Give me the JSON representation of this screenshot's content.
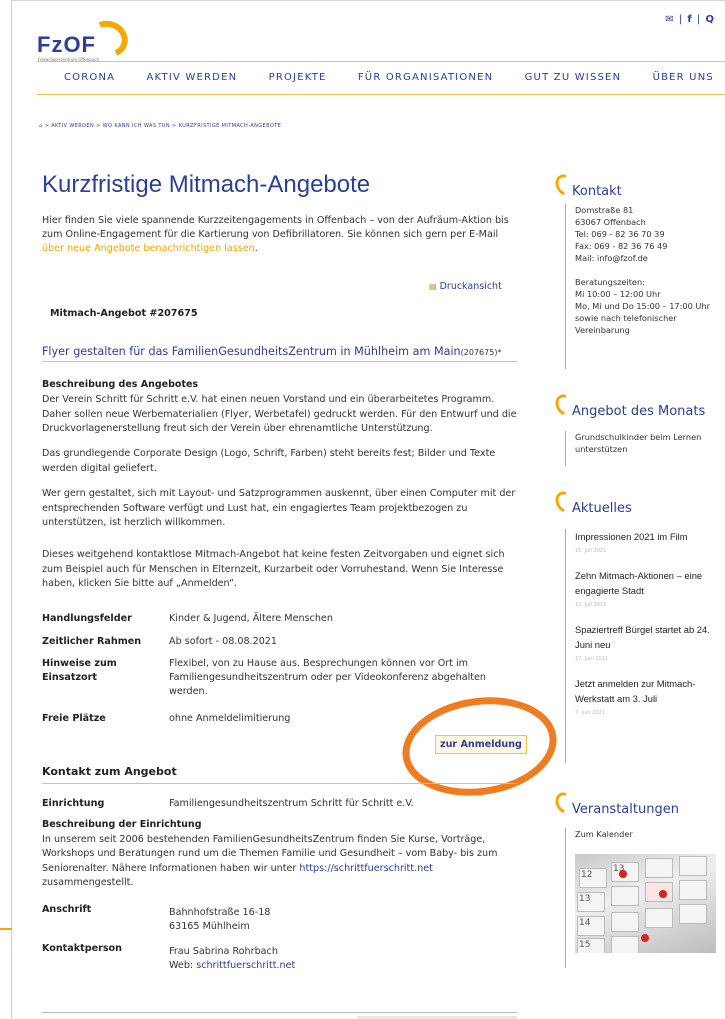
{
  "header": {
    "logo": "FzOF",
    "logo_sub": "Freiwilligenzentrum Offenbach",
    "icons": [
      "mail-icon",
      "facebook-icon",
      "search-icon"
    ],
    "icon_glyphs": [
      "✉",
      "f",
      "Q"
    ],
    "nav": [
      "CORONA",
      "AKTIV WERDEN",
      "PROJEKTE",
      "FÜR ORGANISATIONEN",
      "GUT ZU WISSEN",
      "ÜBER UNS"
    ]
  },
  "breadcrumb": "⌂ > AKTIV WERDEN > WO KANN ICH WAS TUN > KURZFRISTIGE MITMACH-ANGEBOTE",
  "page": {
    "title": "Kurzfristige Mitmach-Angebote",
    "intro": "Hier finden Sie viele spannende Kurzzeitengagements in Offenbach – von der Aufräum-Aktion bis zum Online-Engagement für die Kartierung von Defibrillatoren. Sie können sich gern per E-Mail ",
    "intro_link": "über neue Angebote benachrichtigen lassen",
    "intro_end": ".",
    "print": "Druckansicht",
    "offer_id": "Mitmach-Angebot #207675",
    "offer_title": "Flyer gestalten für das FamilienGesundheitsZentrum in Mühlheim am Main",
    "offer_suffix": "(207675)*",
    "desc_heading": "Beschreibung des Angebotes",
    "paras": [
      "Der Verein Schritt für Schritt e.V. hat einen neuen Vorstand und ein überarbeitetes Programm. Daher sollen neue Werbematerialien (Flyer, Werbetafel) gedruckt werden. Für den Entwurf und die Druckvorlagenerstellung freut sich der Verein über ehrenamtliche Unterstützung.",
      "Das grundlegende Corporate Design (Logo, Schrift, Farben) steht bereits fest; Bilder und Texte werden digital geliefert.",
      "Wer gern gestaltet, sich mit Layout- und Satzprogrammen auskennt, über einen Computer mit der entsprechenden Software verfügt und Lust hat, ein engagiertes Team projektbezogen zu unterstützen, ist herzlich willkommen.",
      "Dieses weitgehend kontaktlose Mitmach-Angebot hat keine festen Zeitvorgaben und eignet sich zum Beispiel auch für Menschen in Elternzeit, Kurzarbeit oder Vorruhestand. Wenn Sie Interesse haben, klicken Sie bitte auf „Anmelden“."
    ],
    "details": [
      {
        "k": "Handlungsfelder",
        "v": "Kinder & Jugend, Ältere Menschen"
      },
      {
        "k": "Zeitlicher Rahmen",
        "v": "Ab sofort - 08.08.2021"
      },
      {
        "k": "Hinweise zum Einsatzort",
        "v": "Flexibel, von zu Hause aus. Besprechungen können vor Ort im Familiengesundheitszentrum oder per Videokonferenz abgehalten werden."
      },
      {
        "k": "Freie Plätze",
        "v": "ohne Anmeldelimitierung"
      }
    ],
    "register": "zur Anmeldung",
    "contact_heading": "Kontakt zum Angebot",
    "einrichtung_k": "Einrichtung",
    "einrichtung_v": "Familiengesundheitszentrum Schritt für Schritt e.V.",
    "inst_heading": "Beschreibung der Einrichtung",
    "inst_desc": "In unserem seit 2006 bestehenden FamilienGesundheitsZentrum finden Sie Kurse, Vorträge, Workshops und Beratungen rund um die Themen Familie und Gesundheit – vom Baby- bis zum Seniorenalter. Nähere Informationen haben wir unter ",
    "inst_link": "https://schrittfuerschritt.net",
    "inst_end": " zusammengestellt.",
    "anschrift_k": "Anschrift",
    "anschrift_1": "Bahnhofstraße 16-18",
    "anschrift_2": "63165 Mühlheim",
    "person_k": "Kontaktperson",
    "person_v": "Frau Sabrina Rohrbach",
    "web_label": "Web: ",
    "web_link": "schrittfuerschritt.net"
  },
  "sidebar": {
    "kontakt_title": "Kontakt",
    "kontakt_lines": [
      "Domstraße 81",
      "63067 Offenbach",
      "Tel: 069 - 82 36 70 39",
      "Fax: 069 - 82 36 76 49",
      "Mail: info@fzof.de"
    ],
    "zeiten_lines": [
      "Beratungszeiten:",
      "Mi 10:00 – 12:00 Uhr",
      "Mo, Mi und Do 15:00 – 17:00 Uhr",
      "sowie nach telefonischer",
      "Vereinbarung"
    ],
    "monat_title": "Angebot des Monats",
    "monat_text": "Grundschulkinder beim Lernen unterstützen",
    "aktuelles_title": "Aktuelles",
    "news": [
      {
        "t": "Impressionen 2021 im Film",
        "d": "15. Juli 2021"
      },
      {
        "t": "Zehn Mitmach-Aktionen – eine engagierte Stadt",
        "d": "12. Juli 2021"
      },
      {
        "t": "Spaziertreff Bürgel startet ab 24. Juni neu",
        "d": "17. Juni 2021"
      },
      {
        "t": "Jetzt anmelden zur Mitmach-Werkstatt am 3. Juli",
        "d": "7. Juni 2021"
      }
    ],
    "veranst_title": "Veranstaltungen",
    "kalender": "Zum Kalender"
  },
  "colors": {
    "brand": "#2b3f93",
    "accent": "#f5a800",
    "highlight_circle": "#f07c22"
  }
}
